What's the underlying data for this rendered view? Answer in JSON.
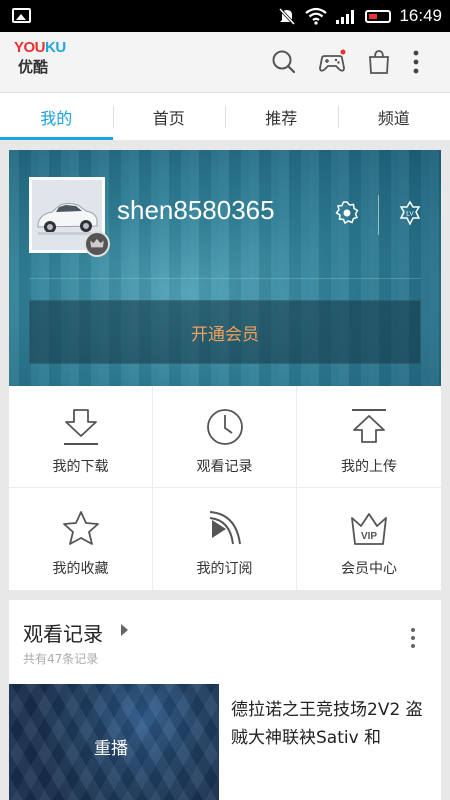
{
  "status_bar": {
    "time": "16:49"
  },
  "app": {
    "logo_en_a": "YOU",
    "logo_en_b": "KU",
    "logo_cn": "优酷"
  },
  "tabs": [
    {
      "label": "我的",
      "active": true
    },
    {
      "label": "首页",
      "active": false
    },
    {
      "label": "推荐",
      "active": false
    },
    {
      "label": "频道",
      "active": false
    }
  ],
  "profile": {
    "username": "shen8580365",
    "vip_button": "开通会员",
    "level_badge": "LV"
  },
  "grid": [
    {
      "label": "我的下载",
      "icon": "download-icon"
    },
    {
      "label": "观看记录",
      "icon": "clock-icon"
    },
    {
      "label": "我的上传",
      "icon": "upload-icon"
    },
    {
      "label": "我的收藏",
      "icon": "star-icon"
    },
    {
      "label": "我的订阅",
      "icon": "subscribe-icon"
    },
    {
      "label": "会员中心",
      "icon": "vip-crown-icon"
    }
  ],
  "history": {
    "title": "观看记录",
    "count": "共有47条记录",
    "item": {
      "replay_label": "重播",
      "title": "德拉诺之王竞技场2V2 盗贼大神联袂Sativ 和"
    }
  },
  "colors": {
    "accent": "#1aa4e8",
    "vip_text": "#f2a05a",
    "logo_red": "#e8312f",
    "logo_blue": "#1fa7e0"
  }
}
